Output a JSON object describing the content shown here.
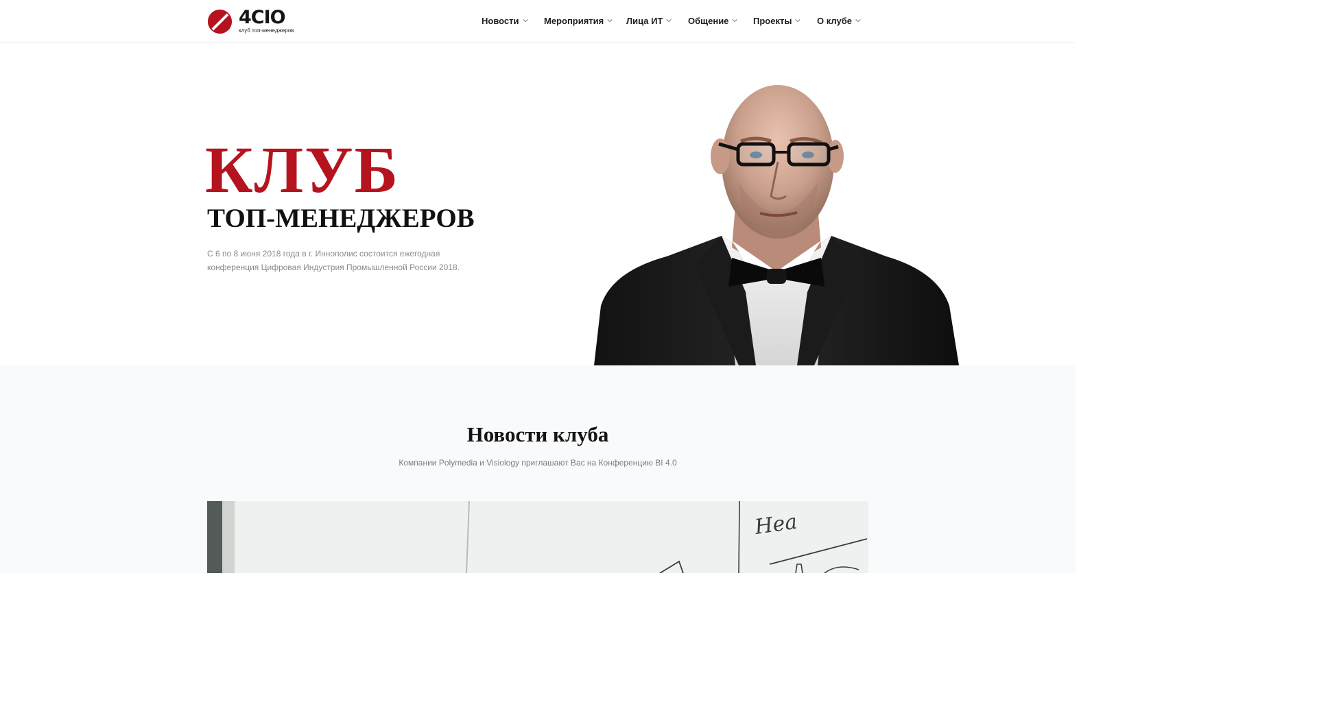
{
  "header": {
    "logo": {
      "name": "4CIO",
      "tagline": "клуб топ-менеджеров"
    },
    "nav": [
      {
        "label": "Новости"
      },
      {
        "label": "Мероприятия"
      },
      {
        "label": "Лица ИТ"
      },
      {
        "label": "Общение"
      },
      {
        "label": "Проекты"
      },
      {
        "label": "О клубе"
      }
    ]
  },
  "hero": {
    "title": "КЛУБ",
    "subtitle": "ТОП-МЕНЕДЖЕРОВ",
    "description": "С 6 по 8 июня 2018 года в г. Иннополис состоится ежегодная конференция Цифровая Индустрия Промышленной России 2018."
  },
  "news": {
    "title": "Новости клуба",
    "subtitle": "Компании Polymedia и Visiology приглашают Вас на Конференцию BI 4.0",
    "image_handwriting": "Hea"
  },
  "colors": {
    "accent": "#b5141f",
    "text": "#111111",
    "muted": "#8a8a8a",
    "section_bg": "#f9fafc"
  },
  "icons": [
    "logo-icon",
    "chevron-down-icon"
  ]
}
